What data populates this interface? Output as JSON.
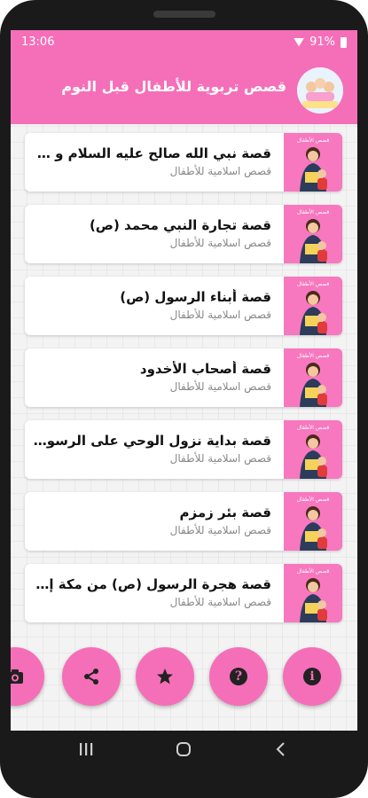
{
  "status": {
    "time": "13:06",
    "battery": "91%"
  },
  "app": {
    "title": "قصص تربوية للأطفال قبل النوم",
    "logo_text": "قصص الأطفال"
  },
  "stories": [
    {
      "title": "قصة نبي الله صالح عليه السلام و معجزة...",
      "subtitle": "قصص اسلامية للأطفال"
    },
    {
      "title": "قصة تجارة النبي محمد (ص)",
      "subtitle": "قصص اسلامية للأطفال"
    },
    {
      "title": "قصة أبناء الرسول (ص)",
      "subtitle": "قصص اسلامية للأطفال"
    },
    {
      "title": "قصة أصحاب الأخدود",
      "subtitle": "قصص اسلامية للأطفال"
    },
    {
      "title": "قصة بداية نزول الوحي على الرسول (ص)",
      "subtitle": "قصص اسلامية للأطفال"
    },
    {
      "title": "قصة بئر زمزم",
      "subtitle": "قصص اسلامية للأطفال"
    },
    {
      "title": "قصة هجرة الرسول (ص) من مكة إلى ال...",
      "subtitle": "قصص اسلامية للأطفال"
    }
  ],
  "thumb_label": "قصص الأطفال",
  "fabs": {
    "camera": "camera-icon",
    "share": "share-icon",
    "star": "star-icon",
    "help": "help-icon",
    "info": "info-icon"
  },
  "fab_glyphs": {
    "help": "?",
    "info": "i"
  },
  "colors": {
    "primary": "#f56fb8",
    "thumb": "#f778bf"
  }
}
